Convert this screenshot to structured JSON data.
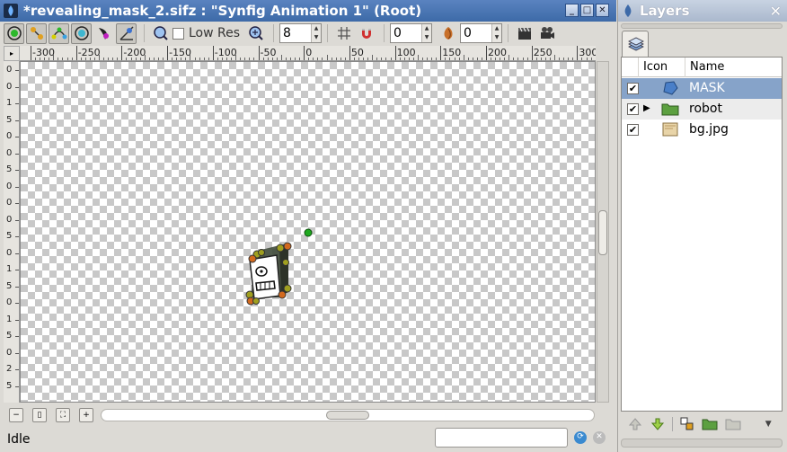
{
  "window": {
    "title": "*revealing_mask_2.sifz : \"Synfig Animation 1\" (Root)",
    "minimize_glyph": "_",
    "maximize_glyph": "□",
    "close_glyph": "✕"
  },
  "toolbar": {
    "low_res_label": "Low Res",
    "low_res_checked": false,
    "resolution_value": "8",
    "onion_past_value": "0",
    "onion_future_value": "0",
    "up_arrow": "▲",
    "down_arrow": "▼"
  },
  "hruler": {
    "ticks": [
      "-300",
      "-250",
      "-200",
      "-150",
      "-100",
      "-50",
      "0",
      "50",
      "100",
      "150",
      "200",
      "250",
      "300"
    ]
  },
  "vruler": {
    "labels": [
      "0",
      "0",
      "1",
      "5",
      "0",
      "0",
      "5",
      "0",
      "0",
      "0",
      "5",
      "0",
      "1",
      "5",
      "0",
      "1",
      "5",
      "0",
      "2",
      "5"
    ],
    "corner_glyph": "▸"
  },
  "status": {
    "text": "Idle"
  },
  "layers_panel": {
    "title": "Layers",
    "close_glyph": "✕",
    "columns": [
      "Icon",
      "Name"
    ],
    "layers": [
      {
        "name": "MASK",
        "checked": true,
        "selected": true,
        "expandable": false,
        "icon": "mask-polygon-icon"
      },
      {
        "name": "robot",
        "checked": true,
        "selected": false,
        "expandable": true,
        "icon": "group-folder-icon"
      },
      {
        "name": "bg.jpg",
        "checked": true,
        "selected": false,
        "expandable": false,
        "icon": "image-icon"
      }
    ],
    "check_glyph": "✔",
    "expander_glyph": "▶"
  },
  "colors": {
    "titlebar": "#3d6aa8",
    "selection": "#86a3c9",
    "duck_green": "#1ea81e",
    "duck_orange": "#d2691e",
    "duck_olive": "#a0a020"
  }
}
